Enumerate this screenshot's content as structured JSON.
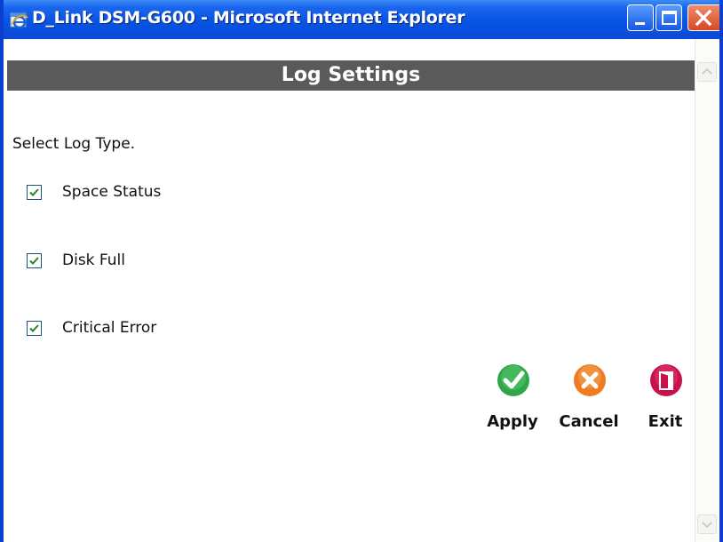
{
  "window": {
    "title": "D_Link DSM-G600 - Microsoft Internet Explorer",
    "title_color": "#0a4ad6",
    "buttons": {
      "minimize": "minimize-icon",
      "maximize": "maximize-icon",
      "close": "close-icon"
    }
  },
  "header": {
    "title": "Log Settings",
    "background": "#5a5a5a"
  },
  "form": {
    "prompt": "Select Log Type.",
    "options": [
      {
        "label": "Space Status",
        "checked": true
      },
      {
        "label": "Disk Full",
        "checked": true
      },
      {
        "label": "Critical Error",
        "checked": true
      }
    ]
  },
  "actions": {
    "apply": {
      "label": "Apply",
      "icon": "checkmark-icon",
      "color": "#2fa64a"
    },
    "cancel": {
      "label": "Cancel",
      "icon": "x-icon",
      "color": "#ec7b22"
    },
    "exit": {
      "label": "Exit",
      "icon": "exit-door-icon",
      "color": "#c8124b"
    }
  }
}
